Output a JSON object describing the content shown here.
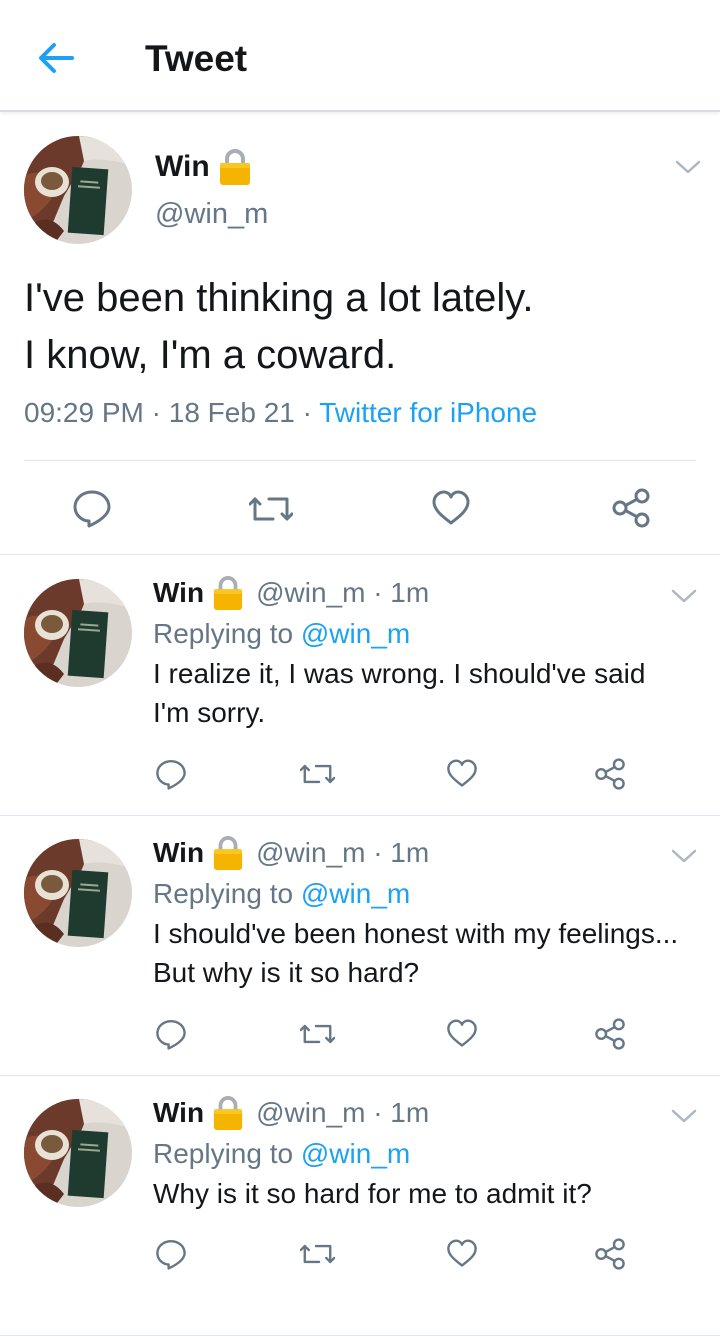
{
  "header": {
    "title": "Tweet",
    "back_icon": "arrow-left-icon"
  },
  "colors": {
    "accent": "#1da1f2",
    "secondary_text": "#657786",
    "icon": "#657786",
    "lock": "#f4b400"
  },
  "main_tweet": {
    "author_name": "Win",
    "handle": "@win_m",
    "text_lines": [
      "I've been thinking a lot lately.",
      "I know, I'm a coward."
    ],
    "time": "09:29 PM",
    "separator": " · ",
    "date": "18 Feb 21",
    "source": "Twitter for iPhone",
    "icons": [
      "reply-icon",
      "retweet-icon",
      "like-icon",
      "share-icon"
    ]
  },
  "replies": [
    {
      "author_name": "Win",
      "handle_time": "@win_m · 1m",
      "replying_label": "Replying to",
      "replying_to": "@win_m",
      "text": "I realize it, I was wrong. I should've said I'm sorry."
    },
    {
      "author_name": "Win",
      "handle_time": "@win_m · 1m",
      "replying_label": "Replying to",
      "replying_to": "@win_m",
      "text": "I should've been honest with my feelings... But why is it so hard?"
    },
    {
      "author_name": "Win",
      "handle_time": "@win_m · 1m",
      "replying_label": "Replying to",
      "replying_to": "@win_m",
      "text": "Why is it so hard for me to admit it?"
    }
  ]
}
